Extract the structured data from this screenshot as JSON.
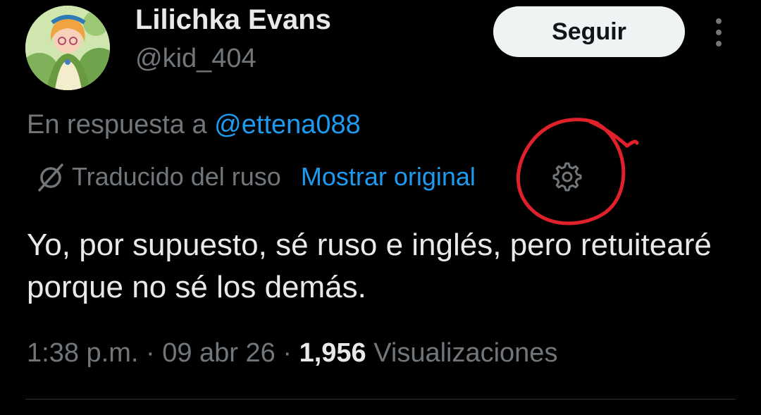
{
  "author": {
    "display_name": "Lilichka Evans",
    "handle": "@kid_404"
  },
  "actions": {
    "follow_label": "Seguir",
    "more_icon": "more-vertical-icon"
  },
  "reply": {
    "prefix": "En respuesta a ",
    "mention": "@ettena088"
  },
  "translation": {
    "label": "Traducido del ruso",
    "show_original_label": "Mostrar original",
    "translate_icon": "translate-icon",
    "settings_icon": "gear-icon"
  },
  "tweet": {
    "text": "Yo, por supuesto, sé ruso e inglés, pero retuitearé porque no sé los demás."
  },
  "meta": {
    "time": "1:38 p.m.",
    "separator": " · ",
    "date": "09 abr 26",
    "views_count": "1,956",
    "views_label": " Visualizaciones"
  },
  "colors": {
    "background": "#000000",
    "text_primary": "#e7e9ea",
    "text_secondary": "#71767b",
    "link": "#1d9bf0",
    "annotation": "#e0202a"
  }
}
